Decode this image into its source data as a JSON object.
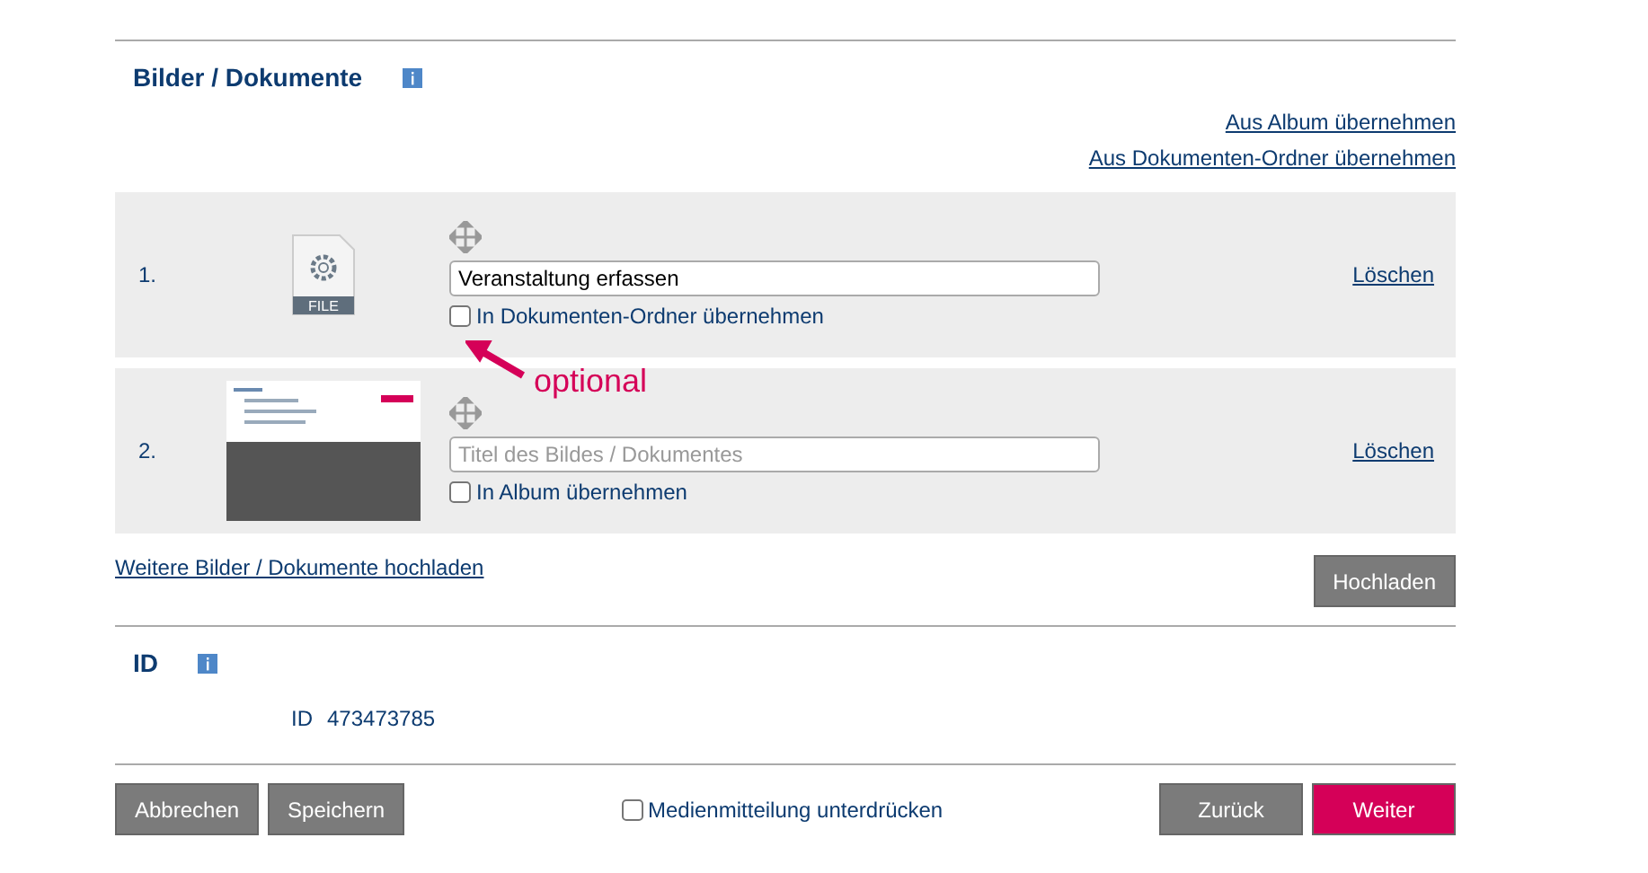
{
  "section": {
    "title": "Bilder / Dokumente",
    "links": [
      "Aus Album übernehmen",
      "Aus Dokumenten-Ordner übernehmen"
    ]
  },
  "items": [
    {
      "number": "1.",
      "kind": "file",
      "title": "Veranstaltung erfassen",
      "file_label": "FILE",
      "checkbox_label": "In Dokumenten-Ordner übernehmen",
      "checked": false,
      "delete": "Löschen",
      "annotation": "optional"
    },
    {
      "number": "2.",
      "kind": "image",
      "placeholder": "Titel des Bildes / Dokumentes",
      "checkbox_label": "In Album übernehmen",
      "checked": false,
      "delete": "Löschen"
    }
  ],
  "upload_more": "Weitere Bilder / Dokumente hochladen",
  "upload_button": "Hochladen",
  "id_section": {
    "title": "ID",
    "label": "ID",
    "value": "473473785"
  },
  "footer": {
    "buttons": [
      {
        "label": "Abbrechen",
        "kind": "grey"
      },
      {
        "label": "Speichern",
        "kind": "grey"
      }
    ],
    "suppress_label": "Medienmitteilung unterdrücken",
    "suppress_checked": false,
    "nav": [
      {
        "label": "Zurück",
        "kind": "grey"
      },
      {
        "label": "Weiter",
        "kind": "primary"
      }
    ]
  }
}
